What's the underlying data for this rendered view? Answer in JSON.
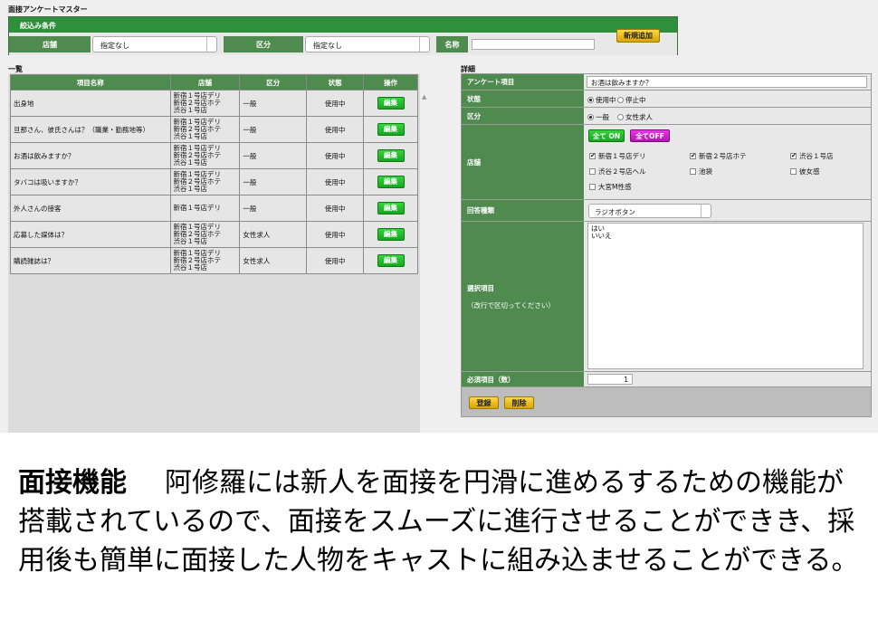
{
  "page_title": "面接アンケートマスター",
  "filter": {
    "title": "絞込み条件",
    "store_label": "店舗",
    "store_value": "指定なし",
    "category_label": "区分",
    "category_value": "指定なし",
    "name_label": "名称",
    "name_value": "",
    "new_button": "新規追加"
  },
  "list": {
    "section_label": "一覧",
    "columns": [
      "項目名称",
      "店舗",
      "区分",
      "状態",
      "操作"
    ],
    "edit_label": "編集",
    "rows": [
      {
        "name": "出身地",
        "stores": "新宿１号店デリ\n新宿２号店ホテ\n渋谷１号店",
        "category": "一般",
        "status": "使用中"
      },
      {
        "name": "旦那さん、彼氏さんは？（職業・勤務地等）",
        "stores": "新宿１号店デリ\n新宿２号店ホテ\n渋谷１号店",
        "category": "一般",
        "status": "使用中"
      },
      {
        "name": "お酒は飲みますか？",
        "stores": "新宿１号店デリ\n新宿２号店ホテ\n渋谷１号店",
        "category": "一般",
        "status": "使用中"
      },
      {
        "name": "タバコは吸いますか？",
        "stores": "新宿１号店デリ\n新宿２号店ホテ\n渋谷１号店",
        "category": "一般",
        "status": "使用中"
      },
      {
        "name": "外人さんの接客",
        "stores": "新宿１号店デリ",
        "category": "一般",
        "status": "使用中"
      },
      {
        "name": "応募した媒体は？",
        "stores": "新宿１号店デリ\n新宿２号店ホテ\n渋谷１号店",
        "category": "女性求人",
        "status": "使用中"
      },
      {
        "name": "購読雑誌は？",
        "stores": "新宿１号店デリ\n新宿２号店ホテ\n渋谷１号店",
        "category": "女性求人",
        "status": "使用中"
      }
    ]
  },
  "detail": {
    "section_label": "詳細",
    "question_label": "アンケート項目",
    "question_value": "お酒は飲みますか？",
    "status_label": "状態",
    "status_options": [
      "使用中",
      "停止中"
    ],
    "category_label": "区分",
    "category_options": [
      "一般",
      "女性求人"
    ],
    "store_label": "店舗",
    "all_on": "全て ON",
    "all_off": "全てOFF",
    "stores": [
      {
        "name": "新宿１号店デリ",
        "checked": "✔"
      },
      {
        "name": "新宿２号店ホテ",
        "checked": "✔"
      },
      {
        "name": "渋谷１号店",
        "checked": "✔"
      },
      {
        "name": "渋谷２号店ヘル",
        "checked": ""
      },
      {
        "name": "池袋",
        "checked": ""
      },
      {
        "name": "彼女感",
        "checked": ""
      },
      {
        "name": "大宮M性感",
        "checked": ""
      }
    ],
    "answer_type_label": "回答種類",
    "answer_type_value": "ラジオボタン",
    "choices_label": "選択項目",
    "choices_hint": "（改行で区切ってください）",
    "choices_value": "はい\nいいえ",
    "required_label": "必須項目（数）",
    "required_value": "1",
    "register_button": "登録",
    "delete_button": "削除"
  },
  "caption": {
    "heading": "面接機能",
    "body": "阿修羅には新人を面接を円滑に進めるするための機能が搭載されているので、面接をスムーズに進行させることができき、採用後も簡単に面接した人物をキャストに組み込ませることができる。"
  }
}
